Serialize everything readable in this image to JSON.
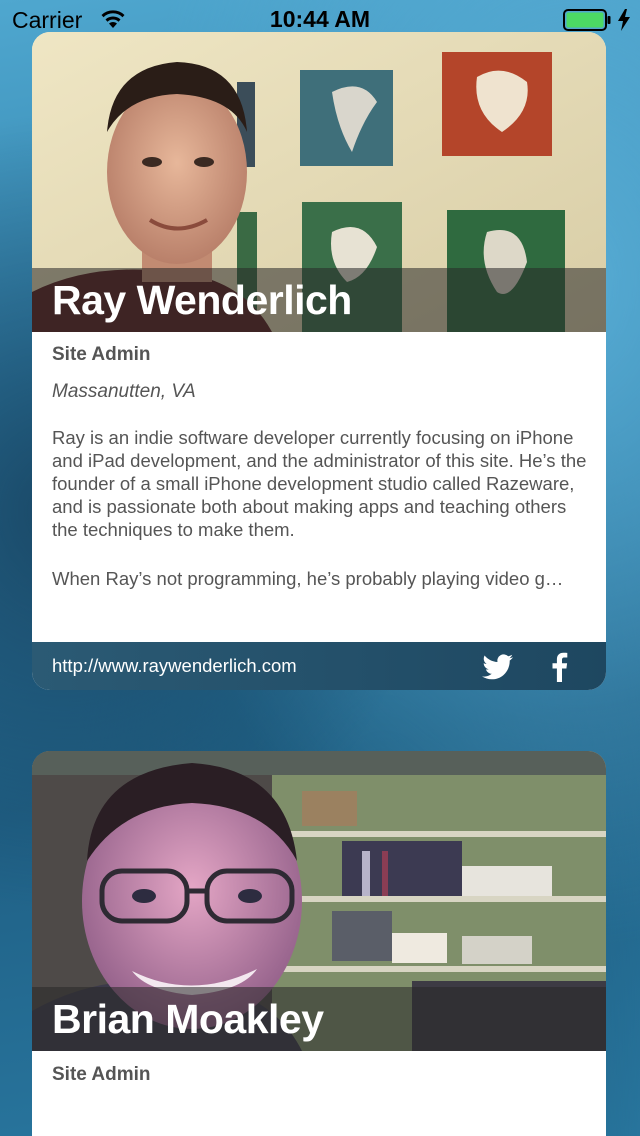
{
  "status_bar": {
    "carrier": "Carrier",
    "time": "10:44 AM",
    "battery_color": "#4cd964"
  },
  "cards": [
    {
      "name": "Ray Wenderlich",
      "role": "Site Admin",
      "location": "Massanutten, VA",
      "bio_paragraph_1": "Ray is an indie software developer currently focusing on iPhone and iPad development, and the administrator of this site. He’s the founder of a small iPhone development studio called Razeware, and is passionate both about making apps and teaching others the techniques to make them.",
      "bio_paragraph_2": "When Ray’s not programming, he’s probably playing video g…",
      "url": "http://www.raywenderlich.com",
      "social_icons": [
        "twitter-icon",
        "facebook-icon"
      ]
    },
    {
      "name": "Brian Moakley",
      "role": "Site Admin"
    }
  ]
}
